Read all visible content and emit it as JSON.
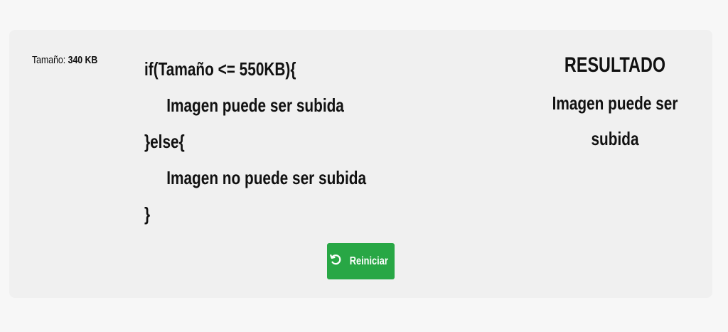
{
  "size_info": {
    "label": "Tamaño:",
    "value": "340 KB"
  },
  "code": {
    "line1": "if(Tamaño <= 550KB){",
    "line2": "Imagen puede ser subida",
    "line3": "}else{",
    "line4": "Imagen no puede ser subida",
    "line5": "}"
  },
  "result": {
    "title": "RESULTADO",
    "text": "Imagen puede ser subida"
  },
  "reset_button": {
    "label": "Reiniciar",
    "icon": "undo-icon",
    "color": "#28a745"
  }
}
